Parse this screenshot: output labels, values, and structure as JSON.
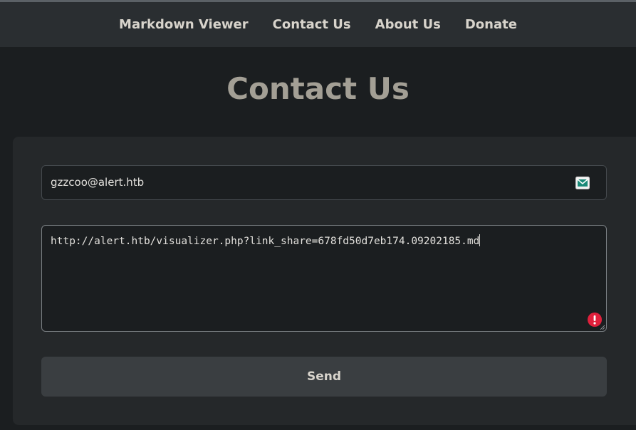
{
  "nav": {
    "items": [
      {
        "label": "Markdown Viewer"
      },
      {
        "label": "Contact Us"
      },
      {
        "label": "About Us"
      },
      {
        "label": "Donate"
      }
    ]
  },
  "page": {
    "title": "Contact Us"
  },
  "form": {
    "email": {
      "value": "gzzcoo@alert.htb",
      "icon": "mail-icon"
    },
    "message": {
      "value": "http://alert.htb/visualizer.php?link_share=678fd50d7eb174.09202185.md",
      "status_icon": "error-icon"
    },
    "send_label": "Send"
  },
  "colors": {
    "background": "#1b1e20",
    "navbar": "#2a2e31",
    "card": "#25282a",
    "title": "#a39f95",
    "button": "#3a3e41",
    "error": "#e0203c",
    "mail_icon": "#1a8a78"
  }
}
